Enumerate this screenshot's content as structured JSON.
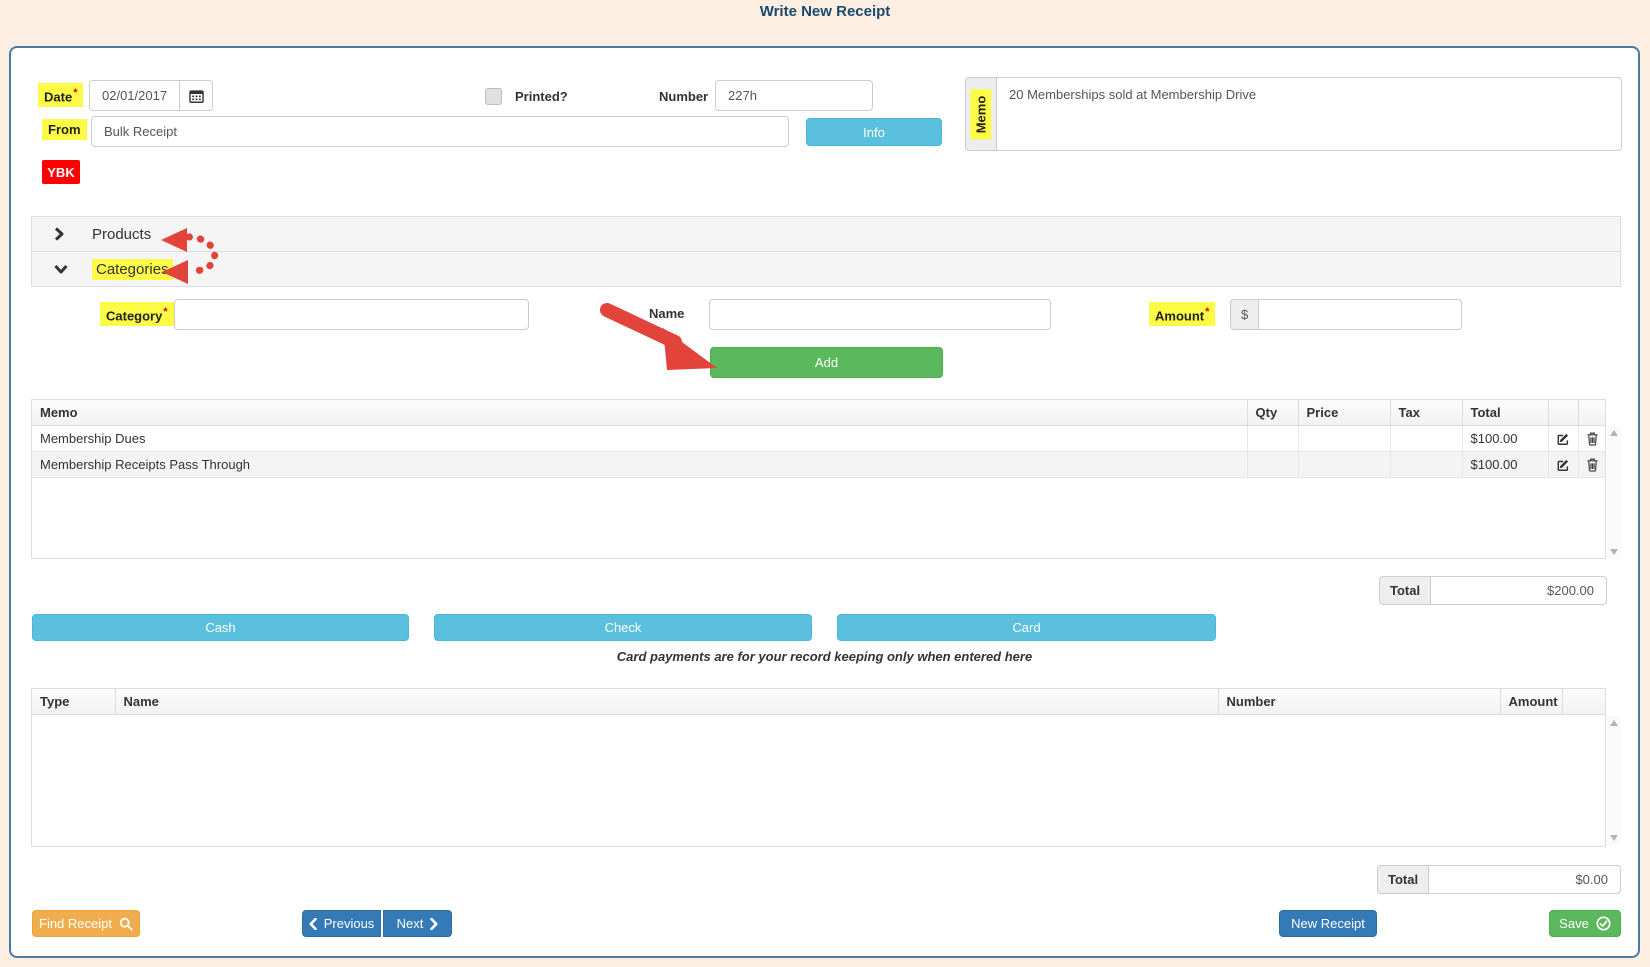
{
  "page": {
    "title": "Write New Receipt"
  },
  "header": {
    "date_label": "Date",
    "date_required": "*",
    "date_value": "02/01/2017",
    "printed_label": "Printed?",
    "number_label": "Number",
    "number_value": "227h",
    "memo_label": "Memo",
    "memo_value": "20 Memberships sold at Membership Drive",
    "from_label": "From",
    "from_value": "Bulk Receipt",
    "info_button_label": "Info",
    "badge_label": "YBK"
  },
  "sections": {
    "products_label": "Products",
    "categories_label": "Categories"
  },
  "category_form": {
    "category_label": "Category",
    "category_required": "*",
    "category_value": "",
    "name_label": "Name",
    "name_value": "",
    "amount_label": "Amount",
    "amount_required": "*",
    "amount_prefix": "$",
    "amount_value": "",
    "add_button_label": "Add"
  },
  "line_items": {
    "columns": [
      "Memo",
      "Qty",
      "Price",
      "Tax",
      "Total"
    ],
    "rows": [
      {
        "memo": "Membership Dues",
        "qty": "",
        "price": "",
        "tax": "",
        "total": "$100.00"
      },
      {
        "memo": "Membership Receipts Pass Through",
        "qty": "",
        "price": "",
        "tax": "",
        "total": "$100.00"
      }
    ],
    "total_label": "Total",
    "total_value": "$200.00"
  },
  "payments": {
    "cash_button_label": "Cash",
    "check_button_label": "Check",
    "card_button_label": "Card",
    "note": "Card payments are for your record keeping only when entered here",
    "columns": [
      "Type",
      "Name",
      "Number",
      "Amount"
    ],
    "rows": [],
    "total_label": "Total",
    "total_value": "$0.00"
  },
  "footer": {
    "find_receipt_label": "Find Receipt",
    "previous_label": "Previous",
    "next_label": "Next",
    "new_receipt_label": "New Receipt",
    "save_label": "Save"
  },
  "colors": {
    "accent_info": "#5bc0de",
    "accent_success": "#5cb85c",
    "accent_warning": "#f0ad4e",
    "accent_primary": "#337ab7",
    "highlight_yellow": "#fcfc46",
    "badge_red": "#fe0100",
    "annotation_red": "#e2443b",
    "panel_border": "#497ba3",
    "title_color": "#1a4a6e"
  }
}
